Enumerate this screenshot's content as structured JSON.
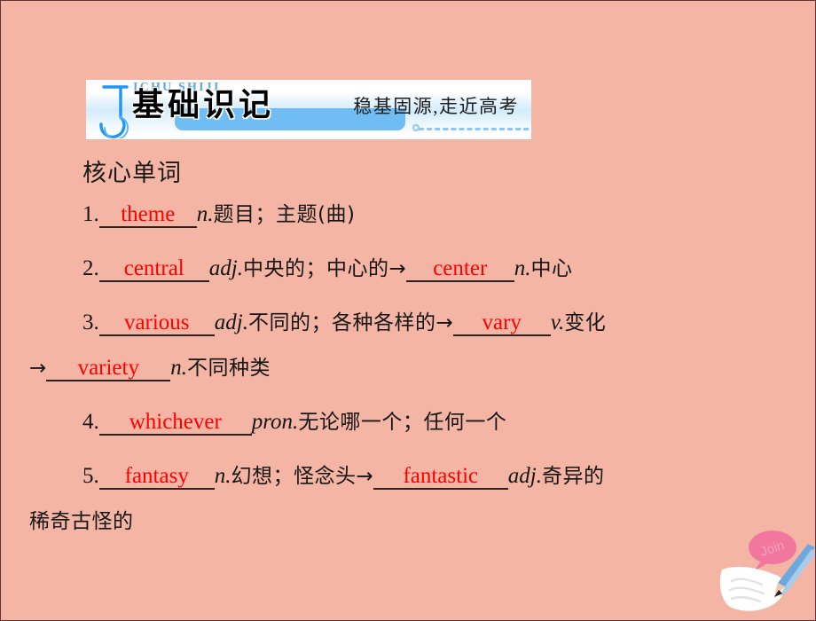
{
  "slide": {
    "background_color": "#F4B5A4",
    "border_color": "#5E3338"
  },
  "banner": {
    "letter_icon": "stylized-letter-j",
    "pinyin": "ICHU SHIJI",
    "title": "基础识记",
    "tagline": "稳基固源,走近高考",
    "accent_color": "#6FBDF2",
    "pinyin_color": "#5FA8DB"
  },
  "section": {
    "heading": "核心单词"
  },
  "answer_color": "#FF0000",
  "words": [
    {
      "number": "1.",
      "segments": [
        {
          "kind": "blank",
          "answer": "theme",
          "width_class": "w-theme"
        },
        {
          "kind": "pos",
          "text": "n."
        },
        {
          "kind": "zh",
          "text": "题目；主题(曲)"
        }
      ]
    },
    {
      "number": "2.",
      "segments": [
        {
          "kind": "blank",
          "answer": "central",
          "width_class": "w-central"
        },
        {
          "kind": "pos",
          "text": "adj."
        },
        {
          "kind": "zh",
          "text": "中央的；中心的"
        },
        {
          "kind": "arrow",
          "text": "→"
        },
        {
          "kind": "blank",
          "answer": "center",
          "width_class": "w-center"
        },
        {
          "kind": "pos",
          "text": "n."
        },
        {
          "kind": "zh",
          "text": "中心"
        }
      ]
    },
    {
      "number": "3.",
      "segments": [
        {
          "kind": "blank",
          "answer": "various",
          "width_class": "w-various"
        },
        {
          "kind": "pos",
          "text": "adj."
        },
        {
          "kind": "zh",
          "text": "不同的；各种各样的"
        },
        {
          "kind": "arrow",
          "text": "→"
        },
        {
          "kind": "blank",
          "answer": "vary",
          "width_class": "w-vary"
        },
        {
          "kind": "pos",
          "text": "v."
        },
        {
          "kind": "zh",
          "text": "变化"
        }
      ],
      "continuation": [
        {
          "kind": "arrow",
          "text": "→"
        },
        {
          "kind": "blank",
          "answer": "variety",
          "width_class": "w-variety"
        },
        {
          "kind": "pos",
          "text": "n."
        },
        {
          "kind": "zh",
          "text": "不同种类"
        }
      ]
    },
    {
      "number": "4.",
      "segments": [
        {
          "kind": "blank",
          "answer": "whichever",
          "width_class": "w-whichever"
        },
        {
          "kind": "pos",
          "text": "pron."
        },
        {
          "kind": "zh",
          "text": "无论哪一个；任何一个"
        }
      ]
    },
    {
      "number": "5.",
      "segments": [
        {
          "kind": "blank",
          "answer": "fantasy",
          "width_class": "w-fantasy"
        },
        {
          "kind": "pos",
          "text": "n."
        },
        {
          "kind": "zh",
          "text": "幻想；怪念头"
        },
        {
          "kind": "arrow",
          "text": "→"
        },
        {
          "kind": "blank",
          "answer": "fantastic",
          "width_class": "w-fantastic"
        },
        {
          "kind": "pos",
          "text": "adj."
        },
        {
          "kind": "zh",
          "text": "奇异的"
        }
      ],
      "continuation": [
        {
          "kind": "zh",
          "text": "稀奇古怪的"
        }
      ]
    }
  ],
  "corner_art": {
    "icon": "pencil-writing-on-paper-icon",
    "bubble_label": "Join",
    "bubble_color": "#F2779F",
    "pencil_color": "#6FA8DC"
  }
}
